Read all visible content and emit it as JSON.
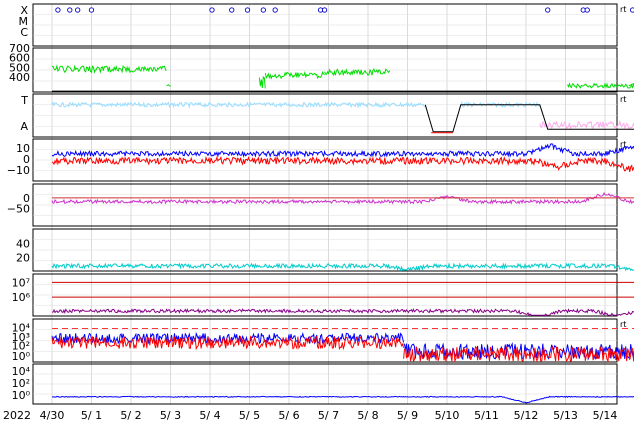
{
  "chart_data": {
    "type": "line",
    "year_label": "2022",
    "x_ticks": [
      "4/30",
      "5/ 1",
      "5/ 2",
      "5/ 3",
      "5/ 4",
      "5/ 5",
      "5/ 6",
      "5/ 7",
      "5/ 8",
      "5/ 9",
      "5/10",
      "5/11",
      "5/12",
      "5/13",
      "5/14"
    ],
    "panels": [
      {
        "id": "xray",
        "ylabels": [
          "X",
          "M",
          "C"
        ],
        "corner": "rt",
        "series": [
          {
            "color": "#ff00ff",
            "baseline": 0.78,
            "noise": 0.1,
            "seed": 11,
            "spikes": [
              [
                0.25,
                0.35
              ],
              [
                0.8,
                0.45
              ],
              [
                1.35,
                0.55
              ],
              [
                2.5,
                0.4
              ],
              [
                3.4,
                0.75
              ],
              [
                4.0,
                0.55
              ],
              [
                4.5,
                0.6
              ],
              [
                5.7,
                0.55
              ],
              [
                6.1,
                0.3
              ],
              [
                7.0,
                0.45
              ],
              [
                11.75,
                0.9
              ],
              [
                13.2,
                0.5
              ],
              [
                13.4,
                0.6
              ],
              [
                14.8,
                0.35
              ]
            ]
          }
        ],
        "markers": [
          0.15,
          0.45,
          0.65,
          1.0,
          4.05,
          4.55,
          4.95,
          5.35,
          5.65,
          6.8,
          6.9,
          12.55,
          13.45,
          13.55,
          14.7
        ]
      },
      {
        "id": "wind-speed",
        "yticks": [
          {
            "label": "700",
            "v": 0.0
          },
          {
            "label": "600",
            "v": 0.22
          },
          {
            "label": "500",
            "v": 0.44
          },
          {
            "label": "400",
            "v": 0.66
          }
        ],
        "series": [
          {
            "color": "#00dd00",
            "segments": [
              [
                0,
                2.9,
                0.48,
                0.07
              ],
              [
                2.9,
                3.0,
                0.85,
                0.02
              ],
              [
                5.25,
                5.4,
                0.78,
                0.15
              ],
              [
                5.4,
                6.9,
                0.62,
                0.07
              ],
              [
                6.9,
                8.55,
                0.55,
                0.07
              ],
              [
                13.05,
                15.0,
                0.86,
                0.05
              ]
            ],
            "seed": 21,
            "ramp_end": [
              14.6,
              15.0,
              0.7
            ]
          },
          {
            "color": "#000000",
            "segments": [
              [
                0,
                15.0,
                0.98,
                0.0
              ]
            ],
            "seed": 0
          }
        ]
      },
      {
        "id": "temperature-density",
        "ylabels": [
          "T",
          "A"
        ],
        "corner": "rt",
        "series": [
          {
            "color": "#99ddff",
            "segments": [
              [
                0,
                9.45,
                0.25,
                0.05
              ],
              [
                10.35,
                12.35,
                0.25,
                0.05
              ]
            ],
            "seed": 31
          },
          {
            "color": "#ffaaee",
            "segments": [
              [
                12.35,
                15.0,
                0.72,
                0.08
              ]
            ],
            "seed": 32
          },
          {
            "color": "#000000",
            "path": [
              [
                9.45,
                0.25
              ],
              [
                9.65,
                0.88
              ],
              [
                10.15,
                0.88
              ],
              [
                10.35,
                0.25
              ],
              [
                12.35,
                0.25
              ],
              [
                12.55,
                0.82
              ],
              [
                15.0,
                0.82
              ]
            ]
          },
          {
            "color": "#ff0000",
            "path": [
              [
                9.6,
                0.9
              ],
              [
                10.15,
                0.9
              ]
            ]
          }
        ]
      },
      {
        "id": "magnetic-field",
        "yticks": [
          {
            "label": "10",
            "v": 0.22
          },
          {
            "label": "0",
            "v": 0.48
          },
          {
            "label": "−10",
            "v": 0.74
          }
        ],
        "corner": "rt",
        "series": [
          {
            "color": "#0000ff",
            "segments": [
              [
                0,
                15.0,
                0.35,
                0.06
              ]
            ],
            "seed": 41,
            "bump": [
              [
                12.6,
                0.2
              ],
              [
                14.6,
                0.15
              ]
            ]
          },
          {
            "color": "#ff0000",
            "segments": [
              [
                0,
                15.0,
                0.52,
                0.08
              ]
            ],
            "seed": 42,
            "bump": [
              [
                12.8,
                -0.15
              ],
              [
                14.6,
                -0.2
              ]
            ]
          }
        ]
      },
      {
        "id": "bz-component",
        "yticks": [
          {
            "label": "0",
            "v": 0.33
          },
          {
            "label": "−50",
            "v": 0.58
          }
        ],
        "series": [
          {
            "color": "#cc33cc",
            "segments": [
              [
                0,
                15.0,
                0.42,
                0.04
              ]
            ],
            "seed": 51,
            "bump": [
              [
                10.0,
                0.12
              ],
              [
                14.0,
                0.2
              ]
            ]
          },
          {
            "color": "#cc3333",
            "path": [
              [
                0,
                0.33
              ],
              [
                15.0,
                0.33
              ]
            ]
          }
        ]
      },
      {
        "id": "kp-index",
        "yticks": [
          {
            "label": "40",
            "v": 0.35
          },
          {
            "label": "20",
            "v": 0.68
          }
        ],
        "series": [
          {
            "color": "#00cccc",
            "segments": [
              [
                0,
                15.0,
                0.88,
                0.05
              ]
            ],
            "seed": 61,
            "bump": [
              [
                9.0,
                -0.1
              ],
              [
                14.8,
                -0.12
              ]
            ]
          }
        ]
      },
      {
        "id": "proton-flux",
        "yticks": [
          {
            "label": "10⁷",
            "v": 0.2
          },
          {
            "label": "10⁶",
            "v": 0.55
          }
        ],
        "series": [
          {
            "color": "#880088",
            "segments": [
              [
                0,
                15.0,
                0.88,
                0.04
              ]
            ],
            "seed": 71,
            "bump": [
              [
                12.3,
                -0.15
              ],
              [
                14.3,
                -0.12
              ]
            ]
          },
          {
            "color": "#cc0000",
            "path": [
              [
                0,
                0.2
              ],
              [
                15.0,
                0.2
              ]
            ]
          },
          {
            "color": "#cc0000",
            "path": [
              [
                0,
                0.55
              ],
              [
                15.0,
                0.55
              ]
            ]
          }
        ]
      },
      {
        "id": "electron-flux",
        "yticks": [
          {
            "label": "10⁴",
            "v": 0.2
          },
          {
            "label": "10³",
            "v": 0.42
          },
          {
            "label": "10²",
            "v": 0.62
          },
          {
            "label": "10⁰",
            "v": 0.86
          }
        ],
        "corner": "rt",
        "series": [
          {
            "color": "#0000ff",
            "segments": [
              [
                0,
                8.9,
                0.45,
                0.12
              ],
              [
                8.9,
                15.0,
                0.75,
                0.18
              ]
            ],
            "seed": 81
          },
          {
            "color": "#ff0000",
            "segments": [
              [
                0,
                8.9,
                0.55,
                0.14
              ],
              [
                8.9,
                15.0,
                0.82,
                0.18
              ]
            ],
            "seed": 82
          },
          {
            "color": "#ff3333",
            "dash": true,
            "path": [
              [
                0,
                0.22
              ],
              [
                15.0,
                0.22
              ]
            ]
          }
        ]
      },
      {
        "id": "neutron",
        "yticks": [
          {
            "label": "10⁴",
            "v": 0.18
          },
          {
            "label": "10²",
            "v": 0.48
          },
          {
            "label": "10⁰",
            "v": 0.78
          }
        ],
        "series": [
          {
            "color": "#0000ff",
            "segments": [
              [
                0,
                15.0,
                0.82,
                0.01
              ]
            ],
            "seed": 91,
            "bump": [
              [
                12.0,
                -0.15
              ]
            ]
          }
        ]
      }
    ]
  }
}
